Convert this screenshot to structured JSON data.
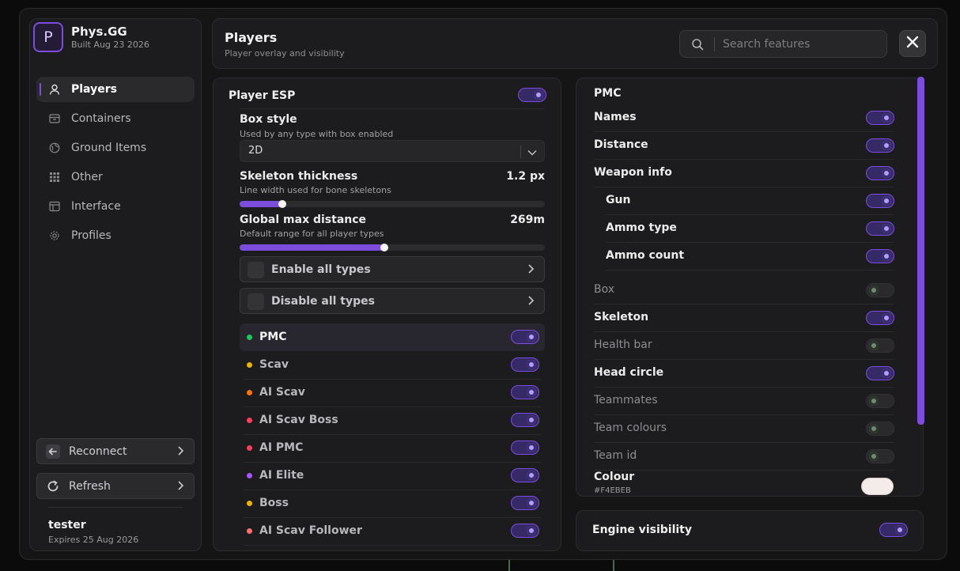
{
  "brand": {
    "logo_letter": "P",
    "name": "Phys.GG",
    "build": "Built Aug 23 2026",
    "accent": "#7C4DDC"
  },
  "sidebar": {
    "items": [
      {
        "label": "Players",
        "icon": "user-icon",
        "active": true
      },
      {
        "label": "Containers",
        "icon": "box-icon",
        "active": false
      },
      {
        "label": "Ground Items",
        "icon": "globe-icon",
        "active": false
      },
      {
        "label": "Other",
        "icon": "grid-icon",
        "active": false
      },
      {
        "label": "Interface",
        "icon": "layout-icon",
        "active": false
      },
      {
        "label": "Profiles",
        "icon": "gear-icon",
        "active": false
      }
    ],
    "reconnect_label": "Reconnect",
    "refresh_label": "Refresh",
    "user": {
      "name": "tester",
      "expires": "Expires 25 Aug 2026"
    }
  },
  "header": {
    "title": "Players",
    "subtitle": "Player overlay and visibility",
    "search_placeholder": "Search features"
  },
  "esp": {
    "title": "Player ESP",
    "enabled": true,
    "box_style": {
      "label": "Box style",
      "sub": "Used by any type with box enabled",
      "value": "2D"
    },
    "skeleton": {
      "label": "Skeleton thickness",
      "sub": "Line width used for bone skeletons",
      "value_text": "1.2 px",
      "fraction": 0.14
    },
    "distance": {
      "label": "Global max distance",
      "sub": "Default range for all player types",
      "value_text": "269m",
      "fraction": 0.475
    },
    "enable_all": "Enable all types",
    "disable_all": "Disable all types",
    "types": [
      {
        "label": "PMC",
        "color": "#22C55E",
        "on": true,
        "selected": true
      },
      {
        "label": "Scav",
        "color": "#EAB308",
        "on": true,
        "selected": false
      },
      {
        "label": "AI Scav",
        "color": "#F97316",
        "on": true,
        "selected": false
      },
      {
        "label": "AI Scav Boss",
        "color": "#F43F5E",
        "on": true,
        "selected": false
      },
      {
        "label": "AI PMC",
        "color": "#F43F5E",
        "on": true,
        "selected": false
      },
      {
        "label": "AI Elite",
        "color": "#A855F7",
        "on": true,
        "selected": false
      },
      {
        "label": "Boss",
        "color": "#EAB308",
        "on": true,
        "selected": false
      },
      {
        "label": "AI Scav Follower",
        "color": "#F87171",
        "on": true,
        "selected": false
      }
    ]
  },
  "pmc": {
    "title": "PMC",
    "rows": [
      {
        "label": "Names",
        "on": true,
        "indent": false
      },
      {
        "label": "Distance",
        "on": true,
        "indent": false
      },
      {
        "label": "Weapon info",
        "on": true,
        "indent": false
      },
      {
        "label": "Gun",
        "on": true,
        "indent": true
      },
      {
        "label": "Ammo type",
        "on": true,
        "indent": true
      },
      {
        "label": "Ammo count",
        "on": true,
        "indent": true
      },
      {
        "label": "Box",
        "on": false,
        "indent": false
      },
      {
        "label": "Skeleton",
        "on": true,
        "indent": false
      },
      {
        "label": "Health bar",
        "on": false,
        "indent": false
      },
      {
        "label": "Head circle",
        "on": true,
        "indent": false
      },
      {
        "label": "Teammates",
        "on": false,
        "indent": false
      },
      {
        "label": "Team colours",
        "on": false,
        "indent": false
      },
      {
        "label": "Team id",
        "on": false,
        "indent": false
      }
    ],
    "colour": {
      "label": "Colour",
      "hex": "#F4EBEB"
    }
  },
  "engine": {
    "label": "Engine visibility",
    "on": true
  }
}
